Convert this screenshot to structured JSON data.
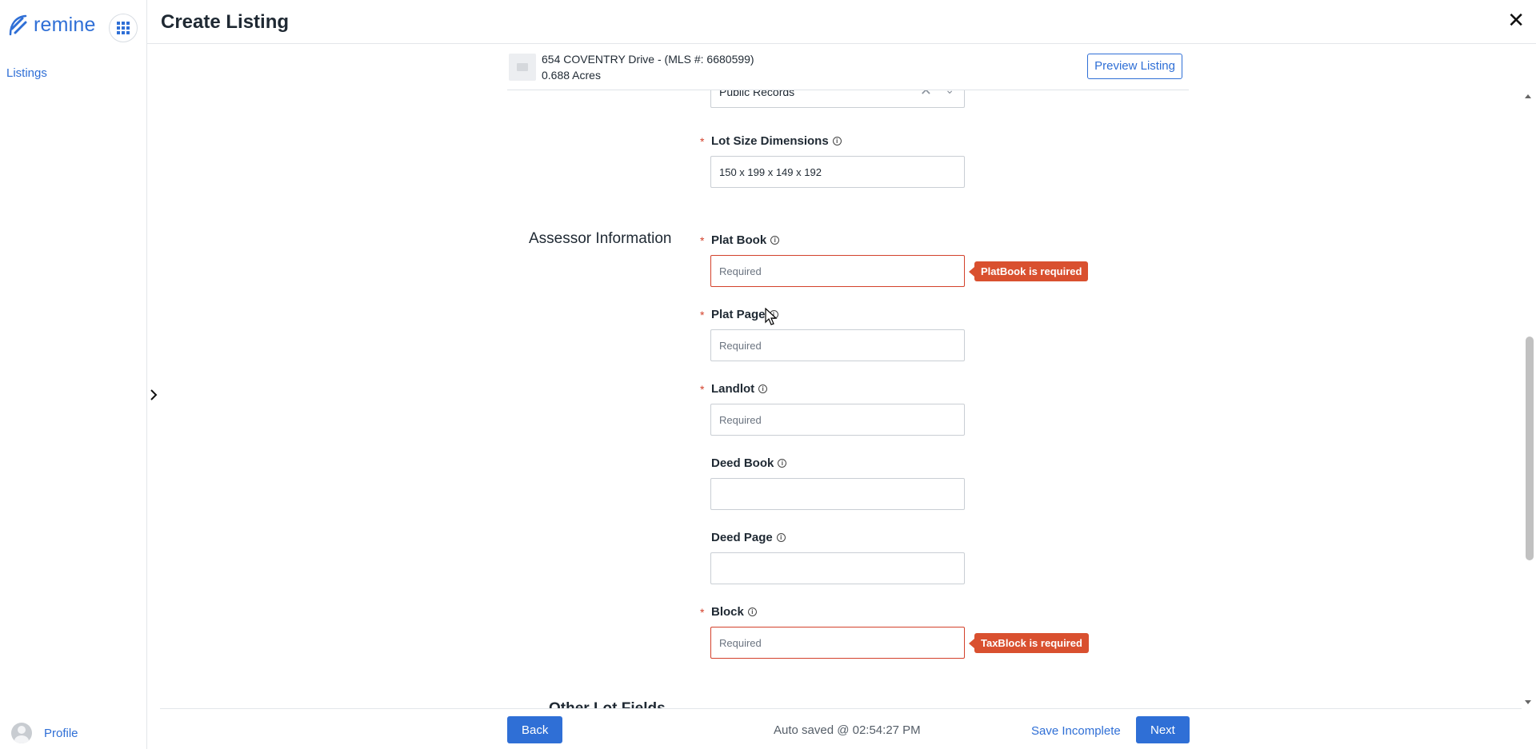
{
  "app": {
    "logo_text": "remine",
    "brand_color": "#2f6fd6",
    "error_color": "#d9502f"
  },
  "sidebar": {
    "nav": [
      {
        "label": "Listings"
      }
    ],
    "profile_label": "Profile"
  },
  "header": {
    "title": "Create Listing",
    "close_icon": "✕"
  },
  "listing": {
    "address": "654 COVENTRY Drive - (MLS #: 6680599)",
    "acres": "0.688 Acres",
    "preview_label": "Preview Listing"
  },
  "form": {
    "source_select": {
      "value": "Public Records"
    },
    "lot_size": {
      "label": "Lot Size Dimensions",
      "value": "150 x 199 x 149 x 192",
      "required": true
    },
    "assessor_section_title": "Assessor Information",
    "other_section_title": "Other Lot Fields",
    "fields": {
      "plat_book": {
        "label": "Plat Book",
        "placeholder": "Required",
        "required": true,
        "error": "PlatBook is required"
      },
      "plat_page": {
        "label": "Plat Page",
        "placeholder": "Required",
        "required": true
      },
      "landlot": {
        "label": "Landlot",
        "placeholder": "Required",
        "required": true
      },
      "deed_book": {
        "label": "Deed Book",
        "placeholder": "",
        "required": false
      },
      "deed_page": {
        "label": "Deed Page",
        "placeholder": "",
        "required": false
      },
      "block": {
        "label": "Block",
        "placeholder": "Required",
        "required": true,
        "error": "TaxBlock is required"
      }
    }
  },
  "footer": {
    "back_label": "Back",
    "autosave": "Auto saved @ 02:54:27 PM",
    "save_incomplete_label": "Save Incomplete",
    "next_label": "Next"
  }
}
